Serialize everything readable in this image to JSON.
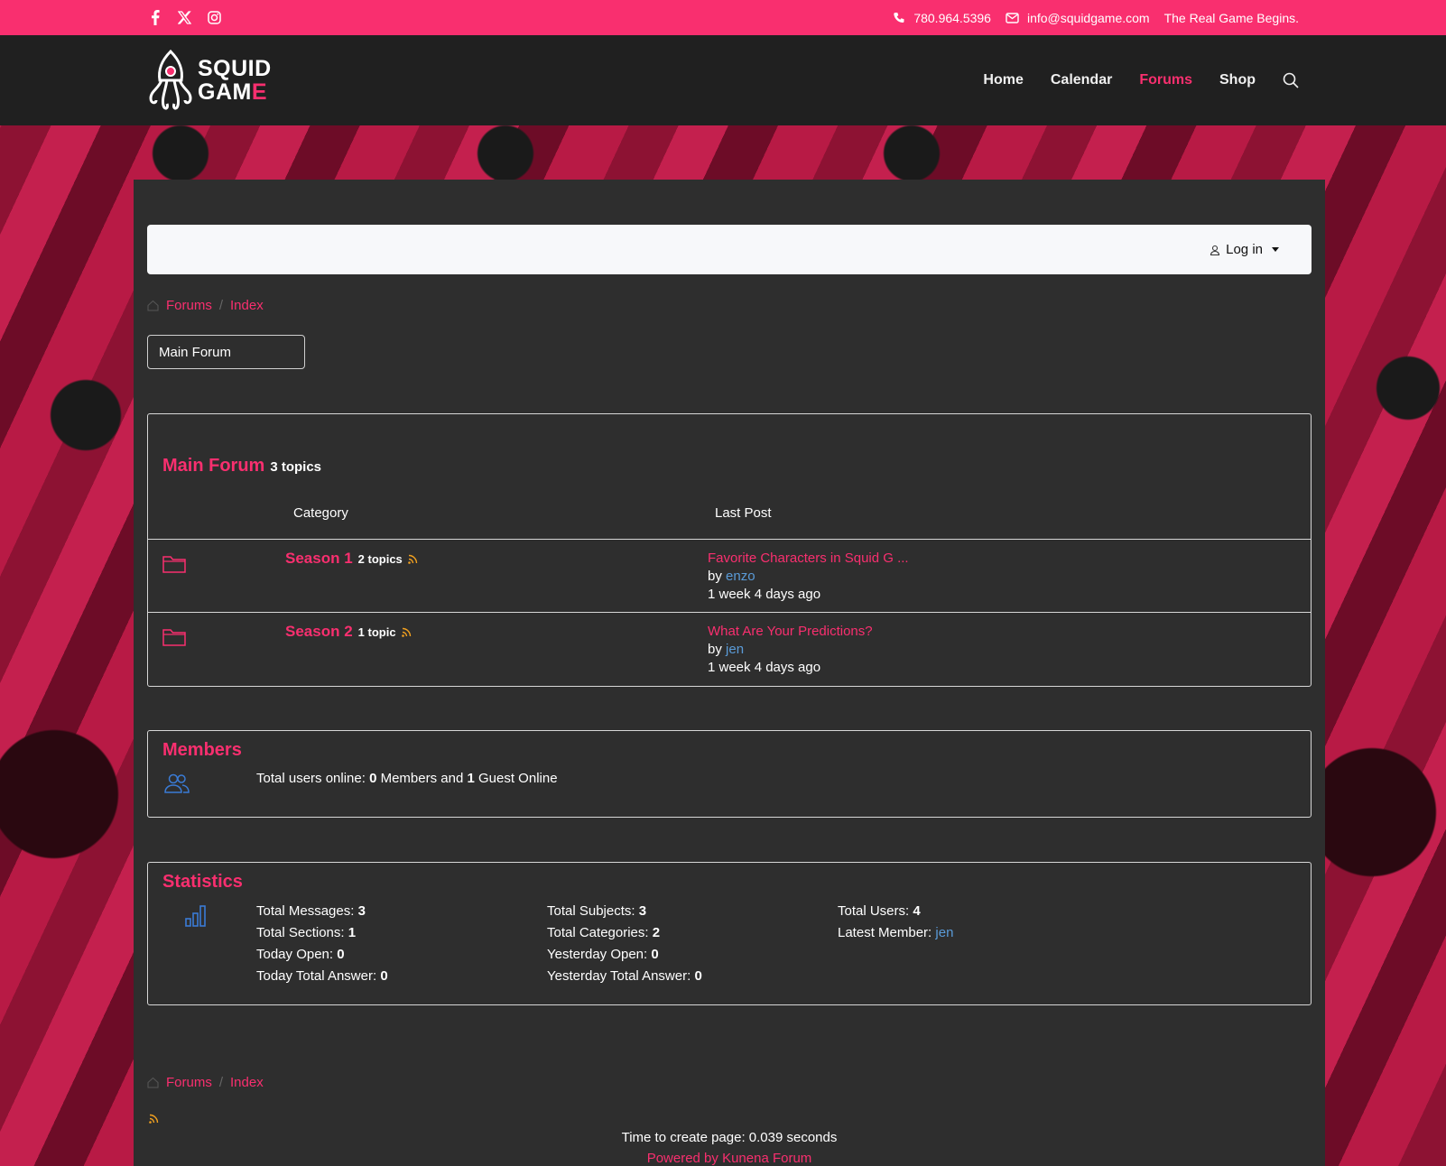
{
  "topbar": {
    "social_icons": [
      "facebook-icon",
      "x-icon",
      "instagram-icon"
    ],
    "phone": "780.964.5396",
    "email": "info@squidgame.com",
    "tagline": "The Real Game Begins."
  },
  "header": {
    "logo_line1": "SQUID",
    "logo_line2": "GAME",
    "nav": [
      "Home",
      "Calendar",
      "Forums",
      "Shop"
    ],
    "active_nav": "Forums"
  },
  "login": {
    "label": "Log in"
  },
  "breadcrumb": {
    "forums": "Forums",
    "index": "Index"
  },
  "forum_select": {
    "value": "Main Forum"
  },
  "main_forum": {
    "title": "Main Forum",
    "count": "3 topics",
    "col_category": "Category",
    "col_last_post": "Last Post",
    "rows": [
      {
        "name": "Season 1",
        "count": "2 topics",
        "last_title": "Favorite Characters in Squid G ...",
        "by": "by",
        "user": "enzo",
        "time": "1 week 4 days ago"
      },
      {
        "name": "Season 2",
        "count": "1 topic",
        "last_title": "What Are Your Predictions?",
        "by": "by",
        "user": "jen",
        "time": "1 week 4 days ago"
      }
    ]
  },
  "members": {
    "title": "Members",
    "text_prefix": "Total users online:",
    "members_count": "0",
    "members_label": "Members and",
    "guest_count": "1",
    "guest_label": "Guest Online"
  },
  "statistics": {
    "title": "Statistics",
    "col1": [
      {
        "label": "Total Messages:",
        "value": "3"
      },
      {
        "label": "Total Sections:",
        "value": "1"
      },
      {
        "label": "Today Open:",
        "value": "0"
      },
      {
        "label": "Today Total Answer:",
        "value": "0"
      }
    ],
    "col2": [
      {
        "label": "Total Subjects:",
        "value": "3"
      },
      {
        "label": "Total Categories:",
        "value": "2"
      },
      {
        "label": "Yesterday Open:",
        "value": "0"
      },
      {
        "label": "Yesterday Total Answer:",
        "value": "0"
      }
    ],
    "col3": [
      {
        "label": "Total Users:",
        "value": "4"
      },
      {
        "label": "Latest Member:",
        "value": "jen"
      }
    ]
  },
  "footer": {
    "time_text": "Time to create page: 0.039 seconds",
    "powered": "Powered by Kunena Forum"
  },
  "colors": {
    "accent": "#f92f6f",
    "link_blue": "#5a9bd8",
    "rss": "#f0a020"
  }
}
